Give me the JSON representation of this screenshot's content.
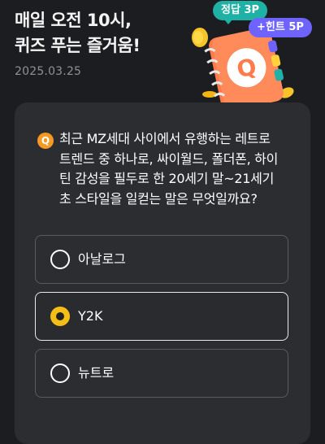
{
  "header": {
    "title_line1": "매일 오전 10시,",
    "title_line2": "퀴즈 푸는 즐거움!",
    "date": "2025.03.25"
  },
  "badges": {
    "answer": "정답 3P",
    "hint": "+힌트 5P"
  },
  "illustration": {
    "letter": "Q"
  },
  "quiz": {
    "q_icon": "Q",
    "question_lines": [
      "최근 MZ세대 사이에서 유행하는 레트로",
      "트렌드 중 하나로, 싸이월드, 폴더폰, 하이",
      "틴 감성을 필두로 한 20세기 말~21세기",
      "초 스타일을 일컫는 말은 무엇일까요?"
    ],
    "options": [
      {
        "label": "아날로그",
        "selected": false
      },
      {
        "label": "Y2K",
        "selected": true
      },
      {
        "label": "뉴트로",
        "selected": false
      }
    ]
  },
  "colors": {
    "background": "#1c1d20",
    "card": "#2c2d31",
    "accent_orange": "#f59a22",
    "answer_badge": "#1fb0a6",
    "hint_badge": "#6f63ff",
    "selected_radio": "#f4be16"
  }
}
